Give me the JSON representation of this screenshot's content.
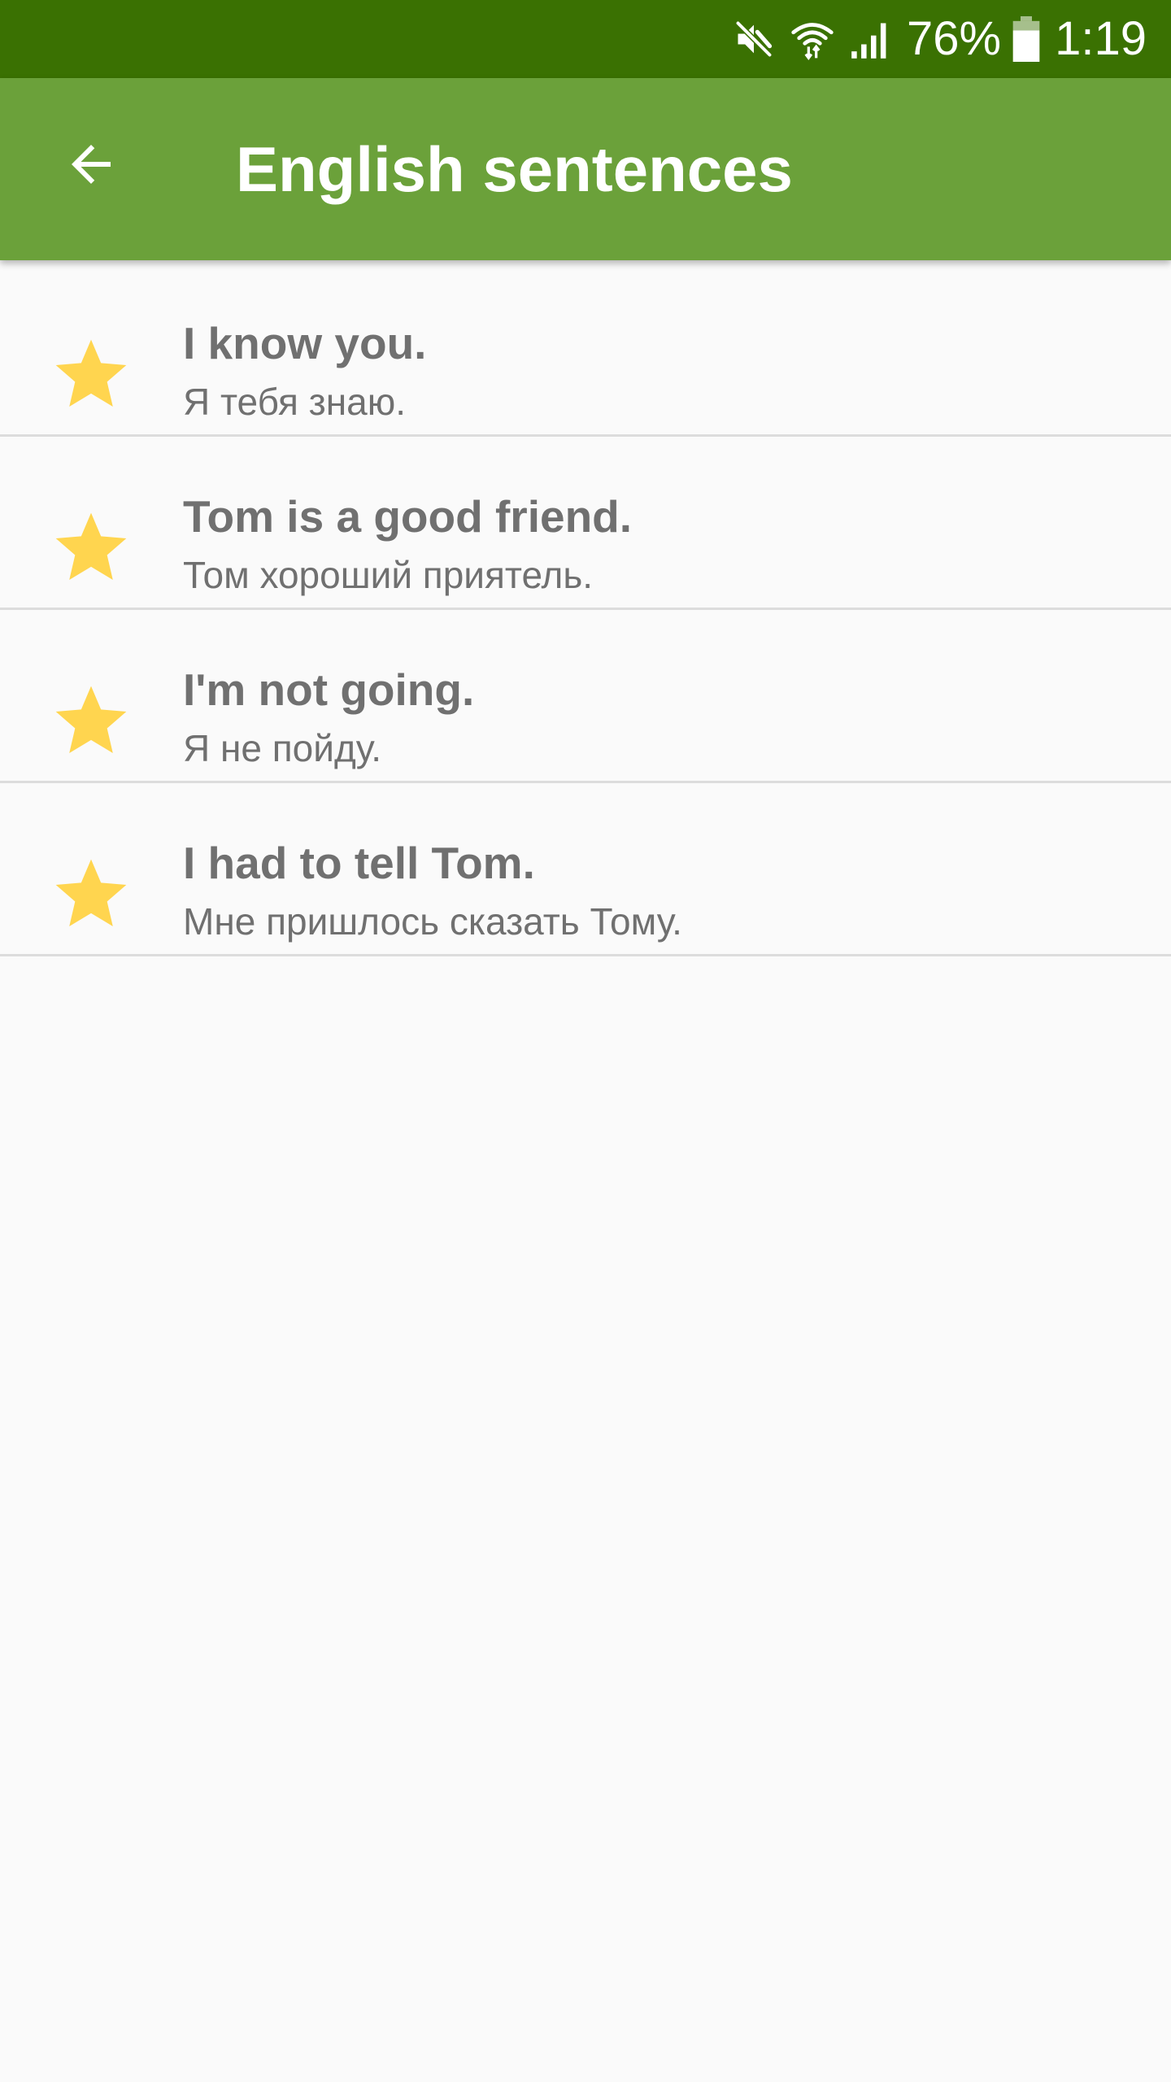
{
  "status_bar": {
    "battery_percent": "76%",
    "time": "1:19",
    "icons": [
      "mute-icon",
      "wifi-icon",
      "signal-icon",
      "battery-icon"
    ]
  },
  "app_bar": {
    "title": "English sentences",
    "back_icon": "arrow-back-icon"
  },
  "colors": {
    "status_bar": "#3a7102",
    "app_bar": "#6ba13a",
    "star": "#ffd54f",
    "text": "#707070",
    "background": "#fafafa"
  },
  "sentences": [
    {
      "english": "I know you.",
      "russian": "Я тебя знаю.",
      "favorite": true
    },
    {
      "english": "Tom is a good friend.",
      "russian": "Том хороший приятель.",
      "favorite": true
    },
    {
      "english": "I'm not going.",
      "russian": "Я не пойду.",
      "favorite": true
    },
    {
      "english": "I had to tell Tom.",
      "russian": "Мне пришлось сказать Тому.",
      "favorite": true
    }
  ]
}
